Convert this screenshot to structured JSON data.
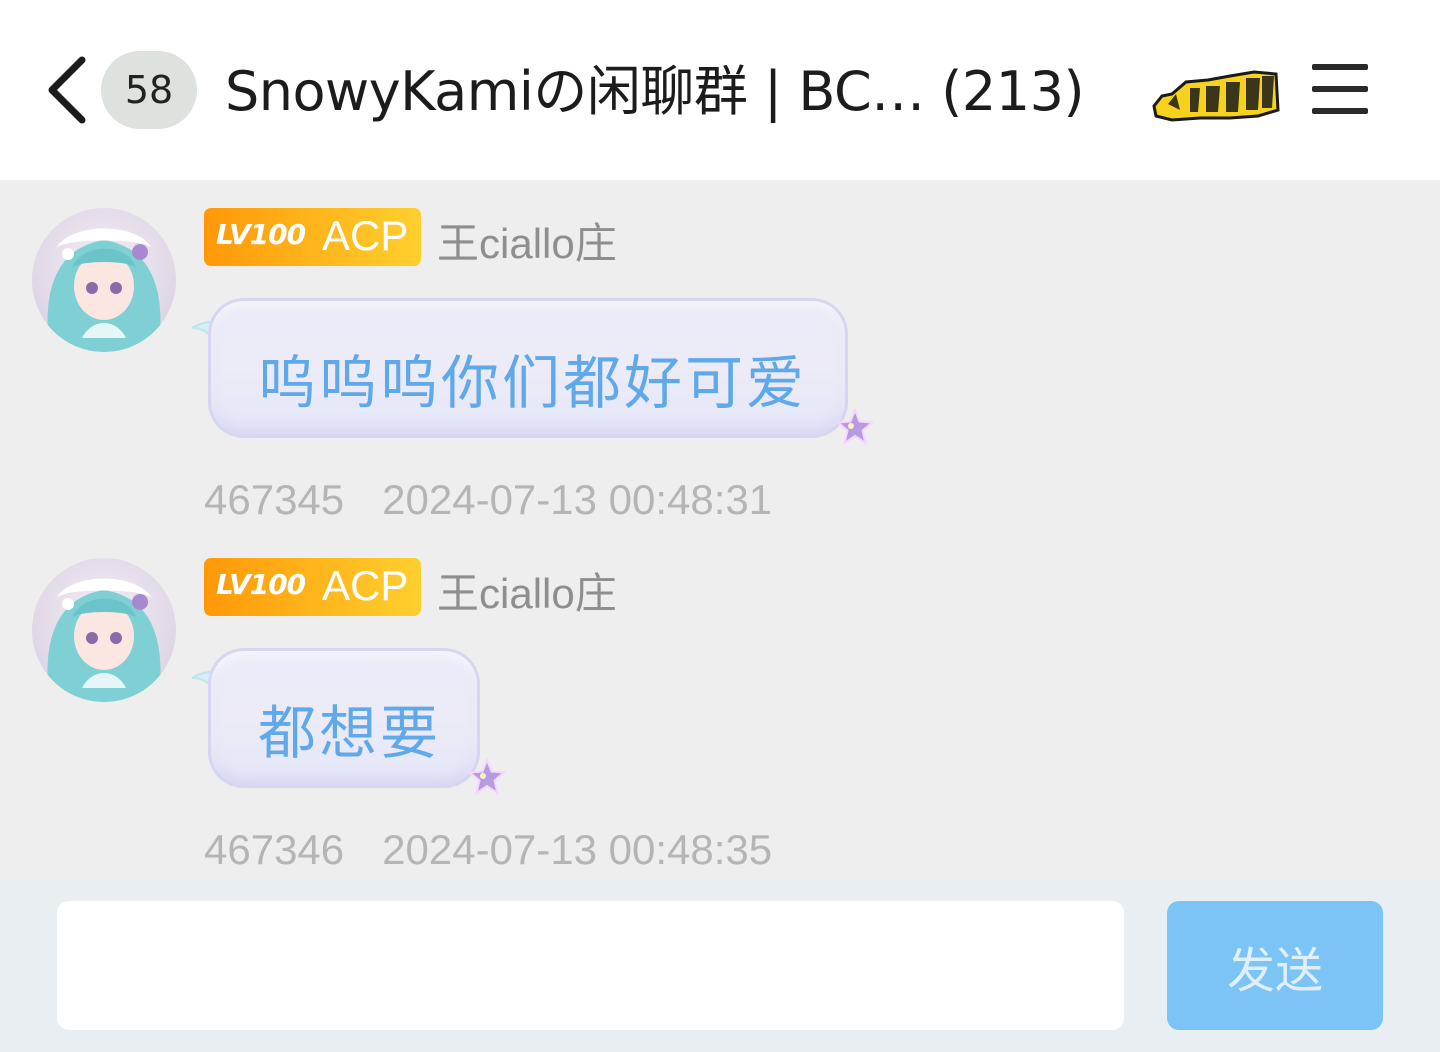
{
  "header": {
    "unread_count": "58",
    "title": "SnowyKamiの闲聊群 | BC… (213)",
    "icons": {
      "back": "chevron-left-icon",
      "menu": "hamburger-menu-icon",
      "sticker": "hooray-sticker-icon"
    }
  },
  "messages": [
    {
      "level": "LV100",
      "title_badge": "ACP",
      "username": "王ciallo庄",
      "text": "呜呜呜你们都好可爱",
      "id": "467345",
      "timestamp": "2024-07-13 00:48:31"
    },
    {
      "level": "LV100",
      "title_badge": "ACP",
      "username": "王ciallo庄",
      "text": "都想要",
      "id": "467346",
      "timestamp": "2024-07-13 00:48:35"
    }
  ],
  "input": {
    "value": "",
    "placeholder": "",
    "send_label": "发送"
  },
  "colors": {
    "chat_bg": "#eeeeee",
    "bubble_text": "#5fa8ea",
    "send_button": "#7cc4f5",
    "level_badge_start": "#ff9808",
    "level_badge_end": "#ffcf2e"
  }
}
